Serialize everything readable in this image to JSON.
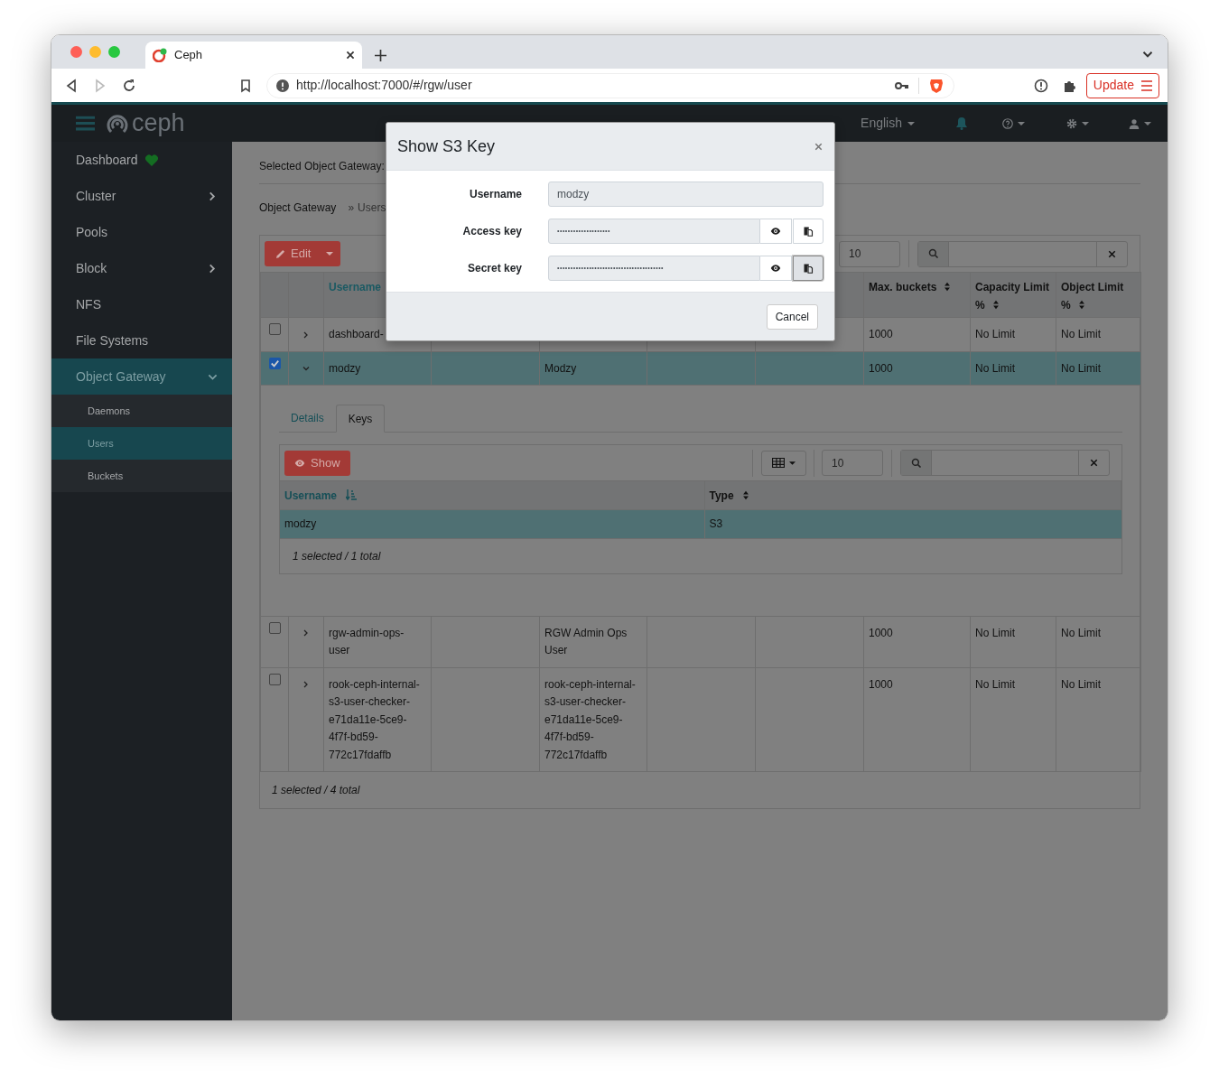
{
  "browser": {
    "tab_title": "Ceph",
    "url": "http://localhost:7000/#/rgw/user",
    "update_label": "Update"
  },
  "navbar": {
    "logo_text": "ceph",
    "language": "English"
  },
  "sidebar": {
    "items": [
      {
        "label": "Dashboard",
        "selected": false,
        "healthy": true
      },
      {
        "label": "Cluster",
        "selected": false,
        "expanded": false
      },
      {
        "label": "Pools",
        "selected": false
      },
      {
        "label": "Block",
        "selected": false,
        "expanded": false
      },
      {
        "label": "NFS",
        "selected": false
      },
      {
        "label": "File Systems",
        "selected": false
      },
      {
        "label": "Object Gateway",
        "selected": true,
        "expanded": true,
        "children": [
          {
            "label": "Daemons",
            "selected": false
          },
          {
            "label": "Users",
            "selected": true
          },
          {
            "label": "Buckets",
            "selected": false
          }
        ]
      }
    ]
  },
  "page": {
    "selected_gateway_label": "Selected Object Gateway:",
    "breadcrumb": [
      {
        "label": "Object Gateway"
      },
      {
        "separator": "»",
        "label": "Users"
      }
    ],
    "toolbar": {
      "edit_label": "Edit",
      "page_size": "10"
    },
    "table": {
      "columns": {
        "username": {
          "label": "Username",
          "sorted": true
        },
        "max_buckets": {
          "label": "Max. buckets",
          "sorted": false
        },
        "capacity_limit": {
          "label": "Capacity Limit %",
          "sorted": false
        },
        "object_limit": {
          "label": "Object Limit %",
          "sorted": false
        }
      },
      "rows": [
        {
          "selected": false,
          "expanded": false,
          "username": "dashboard-",
          "max_buckets": "1000",
          "capacity_limit": "No Limit",
          "object_limit": "No Limit"
        },
        {
          "selected": true,
          "expanded": true,
          "username": "modzy",
          "column_5": "Modzy",
          "max_buckets": "1000",
          "capacity_limit": "No Limit",
          "object_limit": "No Limit"
        },
        {
          "selected": false,
          "expanded": false,
          "username": "rgw-admin-ops-user",
          "column_5": "RGW Admin Ops User",
          "max_buckets": "1000",
          "capacity_limit": "No Limit",
          "object_limit": "No Limit"
        },
        {
          "selected": false,
          "expanded": false,
          "username": "rook-ceph-internal-s3-user-checker-e71da11e-5ce9-4f7f-bd59-772c17fdaffb",
          "column_5": "rook-ceph-internal-s3-user-checker-e71da11e-5ce9-4f7f-bd59-772c17fdaffb",
          "max_buckets": "1000",
          "capacity_limit": "No Limit",
          "object_limit": "No Limit"
        }
      ],
      "footer": "1 selected / 4 total"
    },
    "details": {
      "tabs": [
        {
          "label": "Details",
          "selected": false
        },
        {
          "label": "Keys",
          "selected": true
        }
      ],
      "show_label": "Show",
      "page_size": "10",
      "columns": [
        {
          "label": "Username",
          "sorted": true
        },
        {
          "label": "Type",
          "sorted": false
        }
      ],
      "rows": [
        {
          "username": "modzy",
          "type": "S3",
          "selected": true
        }
      ],
      "footer": "1 selected / 1 total"
    }
  },
  "modal": {
    "title": "Show S3 Key",
    "fields": [
      {
        "kind": "text",
        "label": "Username",
        "value": "modzy"
      },
      {
        "kind": "secret",
        "label": "Access key",
        "value": "••••••••••••••••••••",
        "copy_focused": false
      },
      {
        "kind": "secret",
        "label": "Secret key",
        "value": "••••••••••••••••••••••••••••••••••••••••",
        "copy_focused": true
      }
    ],
    "cancel_label": "Cancel"
  }
}
